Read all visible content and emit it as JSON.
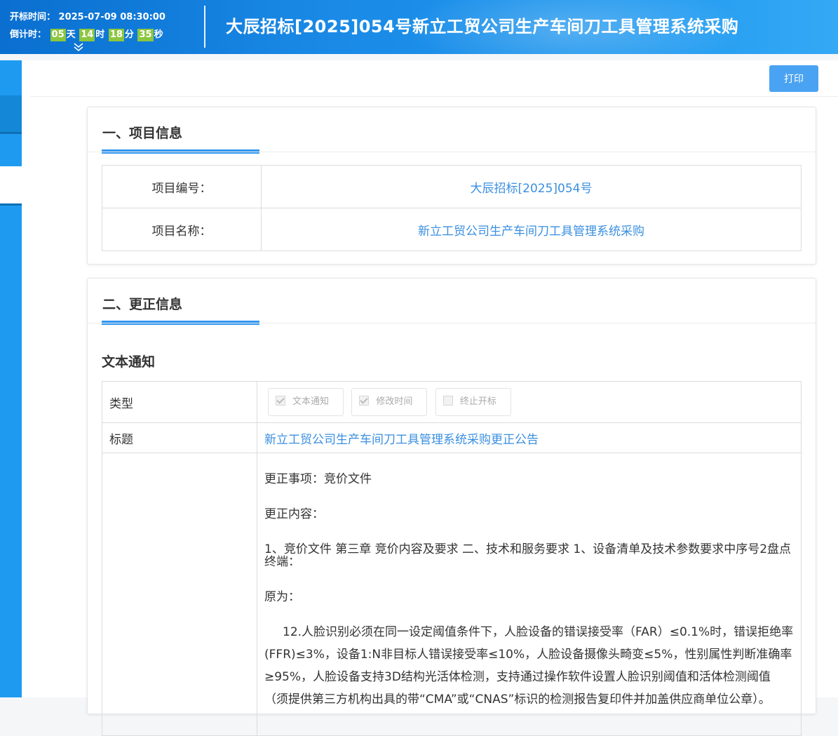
{
  "header": {
    "open_time_label": "开标时间：",
    "open_time_value": "2025-07-09 08:30:00",
    "countdown_label": "倒计时：",
    "days": "05",
    "days_unit": "天",
    "hours": "14",
    "hours_unit": "时",
    "minutes": "18",
    "minutes_unit": "分",
    "seconds": "35",
    "seconds_unit": "秒",
    "title": "大辰招标[2025]054号新立工贸公司生产车间刀工具管理系统采购"
  },
  "toolbar": {
    "print_label": "打印"
  },
  "project_info": {
    "section_title": "一、项目信息",
    "rows": [
      {
        "label": "项目编号：",
        "value": "大辰招标[2025]054号"
      },
      {
        "label": "项目名称：",
        "value": "新立工贸公司生产车间刀工具管理系统采购"
      }
    ]
  },
  "correction": {
    "section_title": "二、更正信息",
    "sub_title": "文本通知",
    "type_label": "类型",
    "types": [
      {
        "label": "文本通知",
        "checked": true
      },
      {
        "label": "修改时间",
        "checked": true
      },
      {
        "label": "终止开标",
        "checked": false
      }
    ],
    "title_label": "标题",
    "title_value": "新立工贸公司生产车间刀工具管理系统采购更正公告",
    "body": {
      "line1": "更正事项：竞价文件",
      "line2": "更正内容：",
      "line3": "1、竞价文件 第三章 竞价内容及要求 二、技术和服务要求 1、设备清单及技术参数要求中序号2盘点终端：",
      "line4": "原为：",
      "line5": "12.人脸识别必须在同一设定阈值条件下，人脸设备的错误接受率（FAR）≤0.1%时，错误拒绝率(FFR)≤3%，设备1:N非目标人错误接受率≤10%，人脸设备摄像头畸变≤5%，性别属性判断准确率≥95%，人脸设备支持3D结构光活体检测，支持通过操作软件设置人脸识别阈值和活体检测阈值（须提供第三方机构出具的带“CMA”或“CNAS”标识的检测报告复印件并加盖供应商单位公章）。"
    }
  },
  "colors": {
    "header_blue": "#1a8ae6",
    "accent": "#3296ef",
    "link": "#3a8fe0",
    "countdown_box": "#8cc63f"
  }
}
